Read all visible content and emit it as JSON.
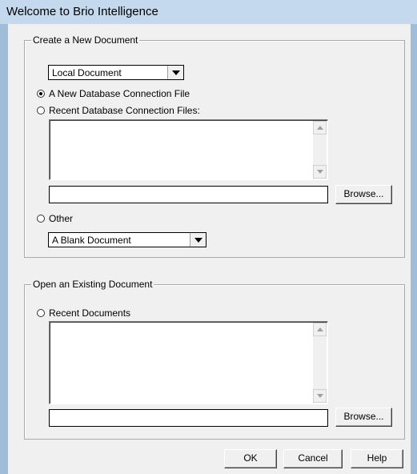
{
  "window": {
    "title": "Welcome to Brio Intelligence"
  },
  "create_group": {
    "legend": "Create a New Document",
    "doc_type_value": "Local Document",
    "radio_new_db": "A New Database Connection File",
    "radio_recent_db": "Recent Database Connection Files:",
    "browse_label": "Browse...",
    "radio_other": "Other",
    "other_value": "A Blank Document",
    "selected_radio": "radio_new_db"
  },
  "open_group": {
    "legend": "Open an Existing Document",
    "radio_recent_docs": "Recent Documents",
    "browse_label": "Browse..."
  },
  "footer": {
    "ok_label": "OK",
    "cancel_label": "Cancel",
    "help_label": "Help"
  }
}
